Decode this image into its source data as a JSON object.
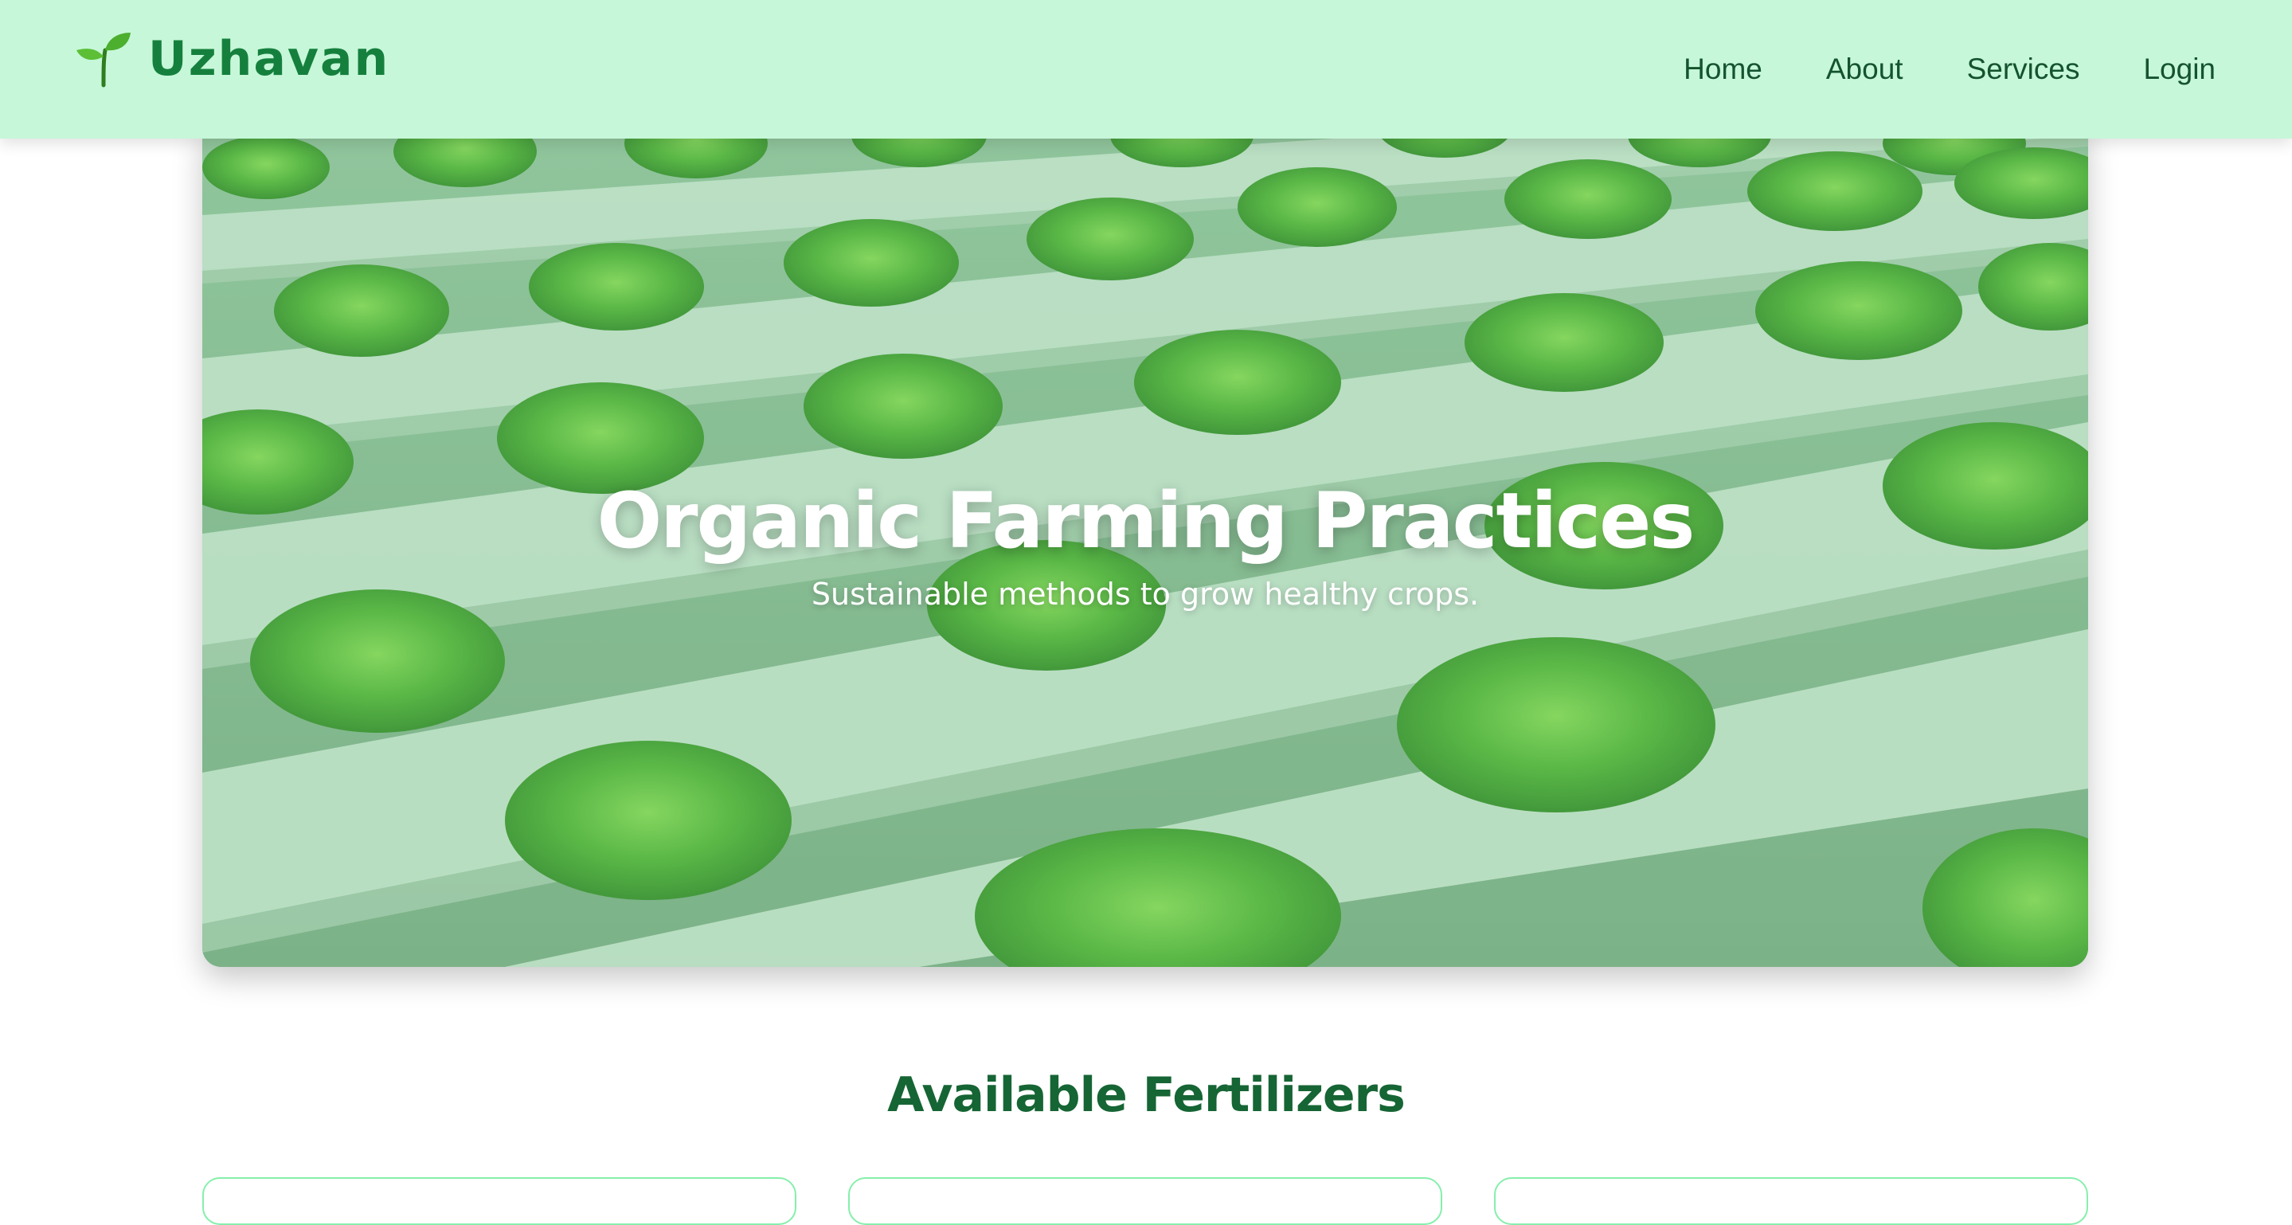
{
  "brand": {
    "name": "Uzhavan",
    "icon": "seedling-icon",
    "color": "#15803d"
  },
  "nav": {
    "items": [
      {
        "label": "Home"
      },
      {
        "label": "About"
      },
      {
        "label": "Services"
      },
      {
        "label": "Login"
      }
    ]
  },
  "hero": {
    "title": "Organic Farming Practices",
    "subtitle": "Sustainable methods to grow healthy crops."
  },
  "fertilizers": {
    "heading": "Available Fertilizers",
    "cards": [
      {},
      {},
      {}
    ]
  },
  "colors": {
    "navbar_bg": "#c6f7d9",
    "heading_green": "#166534",
    "card_border": "#86efac"
  }
}
